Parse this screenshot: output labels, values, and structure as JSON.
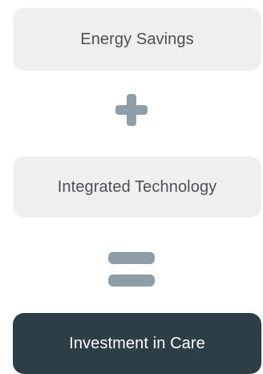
{
  "diagram": {
    "items": [
      {
        "label": "Energy Savings",
        "style": "light"
      },
      {
        "label": "Integrated Technology",
        "style": "light"
      },
      {
        "label": "Investment in Care",
        "style": "dark"
      }
    ],
    "operators": [
      {
        "icon": "plus-icon",
        "color": "#8e9ea8"
      },
      {
        "icon": "equals-icon",
        "color": "#8e9ea8"
      }
    ],
    "colors": {
      "light_card": "#efefef",
      "light_text": "#4a5155",
      "dark_card": "#2e3e46",
      "dark_text": "#ffffff"
    }
  }
}
